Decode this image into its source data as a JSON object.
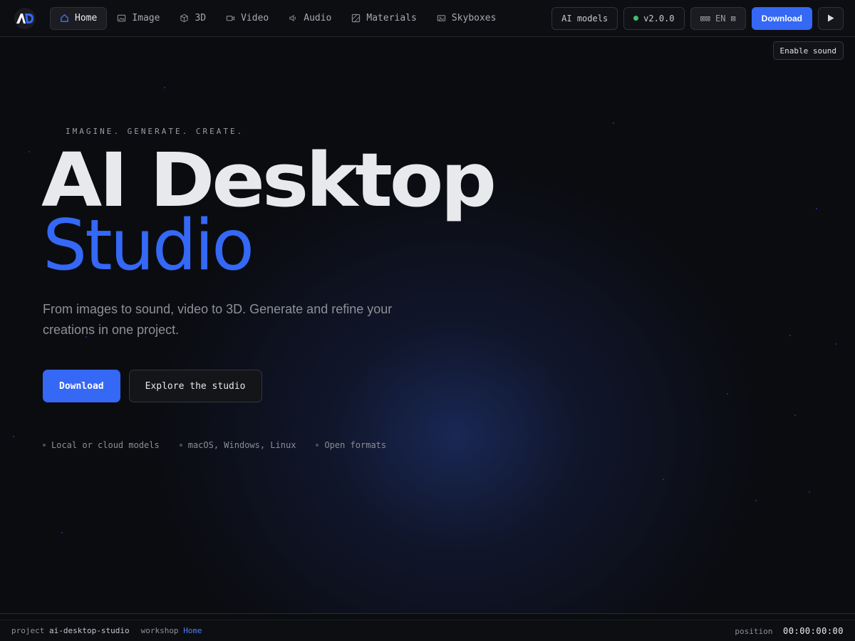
{
  "colors": {
    "accent": "#3468f5",
    "background": "#0b0c10",
    "status_green": "#3fbf6a"
  },
  "nav": {
    "items": [
      {
        "label": "Home",
        "icon": "home-icon",
        "active": true
      },
      {
        "label": "Image",
        "icon": "image-icon"
      },
      {
        "label": "3D",
        "icon": "cube-icon"
      },
      {
        "label": "Video",
        "icon": "video-icon"
      },
      {
        "label": "Audio",
        "icon": "speaker-icon"
      },
      {
        "label": "Materials",
        "icon": "material-icon"
      },
      {
        "label": "Skyboxes",
        "icon": "skybox-icon"
      }
    ]
  },
  "toolbar": {
    "ai_models_label": "AI models",
    "version_label": "v2.0.0",
    "lang_flag": "⊠⊠",
    "lang_label": "EN",
    "lang_caret": "⊠",
    "download_label": "Download",
    "play_icon": "play-icon"
  },
  "sound_tip": "Enable sound",
  "hero": {
    "tagline": "IMAGINE. GENERATE. CREATE.",
    "title_line1": "AI Desktop",
    "title_line2": "Studio",
    "subtitle": "From images to sound, video to 3D. Generate and refine your creations in one project.",
    "cta_primary": "Download",
    "cta_secondary": "Explore the studio",
    "features": [
      "Local or cloud models",
      "macOS, Windows, Linux",
      "Open formats"
    ]
  },
  "footer": {
    "project_label": "project",
    "project_value": "ai-desktop-studio",
    "workshop_label": "workshop",
    "workshop_value": "Home",
    "position_label": "position",
    "position_value": "00:00:00:00"
  }
}
